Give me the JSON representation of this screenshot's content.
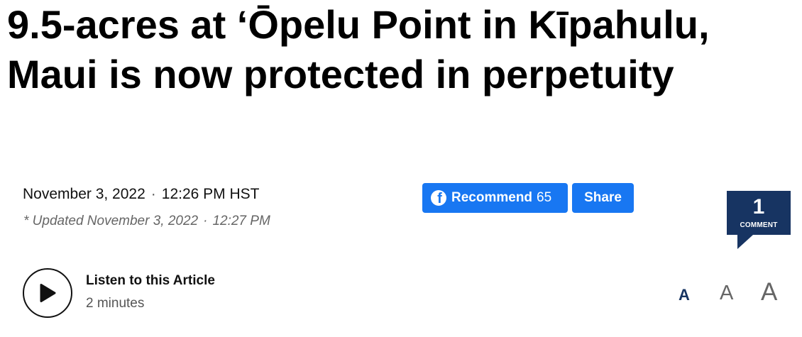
{
  "article": {
    "headline": "9.5-acres at ‘Ōpelu Point in Kīpahulu, Maui is now protected in perpetuity",
    "published_date": "November 3, 2022",
    "published_time": "12:26 PM HST",
    "separator": "·",
    "updated_prefix": "* Updated",
    "updated_date": "November 3, 2022",
    "updated_time": "12:27 PM"
  },
  "social": {
    "facebook_icon": "facebook-f-icon",
    "recommend_label": "Recommend",
    "recommend_count": "65",
    "share_label": "Share",
    "brand_color": "#1877f2"
  },
  "comments": {
    "count": "1",
    "label": "COMMENT",
    "color": "#173462"
  },
  "audio": {
    "play_icon": "play-icon",
    "title": "Listen to this Article",
    "duration": "2 minutes"
  },
  "text_size": {
    "small": "A",
    "medium": "A",
    "large": "A",
    "active": "small"
  }
}
